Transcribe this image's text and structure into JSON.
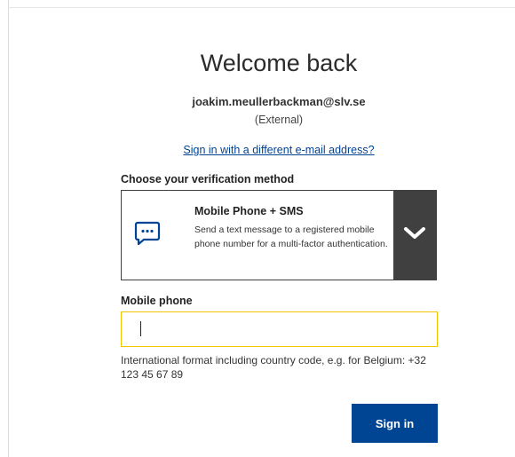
{
  "header": {
    "title": "Welcome back"
  },
  "account": {
    "email": "joakim.meullerbackman@slv.se",
    "type": "(External)",
    "switch_link": "Sign in with a different e-mail address?"
  },
  "verification": {
    "label": "Choose your verification method",
    "selected": {
      "icon": "chat-icon",
      "title": "Mobile Phone + SMS",
      "description": "Send a text message to a registered mobile phone number for a multi-factor authentication."
    },
    "toggle_icon": "chevron-down-icon"
  },
  "phone": {
    "label": "Mobile phone",
    "value": "",
    "help": "International format including country code, e.g. for Belgium: +32 123 45 67 89"
  },
  "actions": {
    "signin_label": "Sign in"
  },
  "colors": {
    "accent": "#004494",
    "input_border": "#f2c500",
    "toggle_bg": "#404040"
  }
}
